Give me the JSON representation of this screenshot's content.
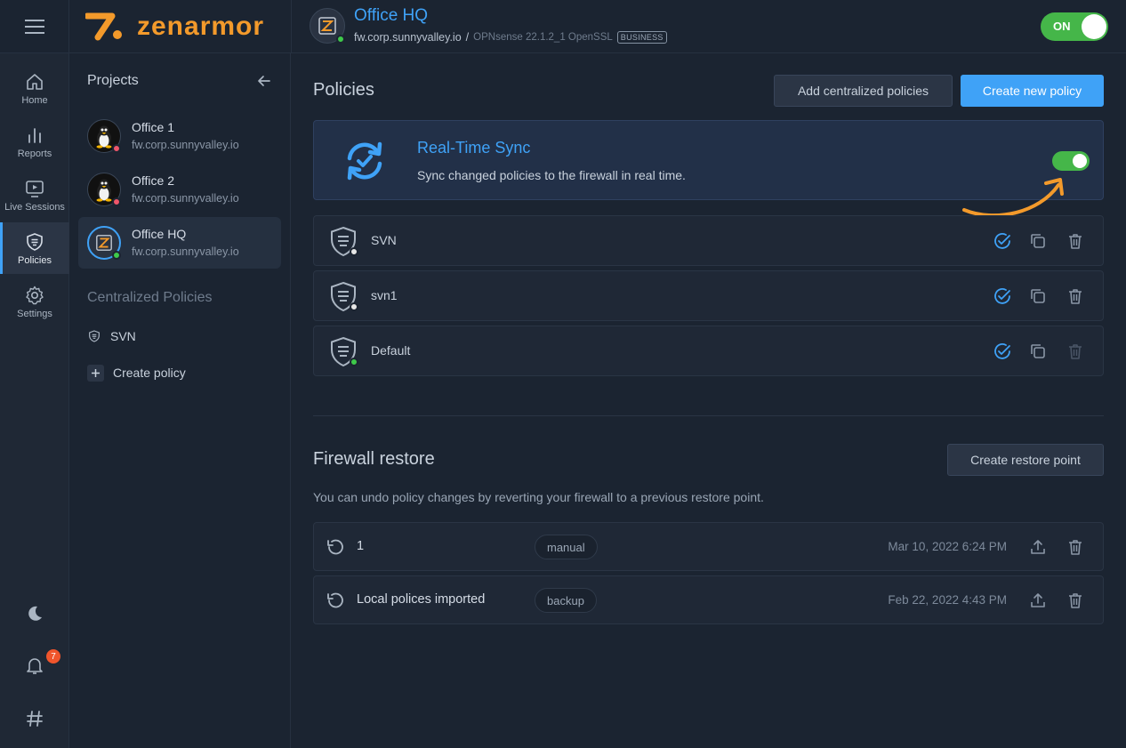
{
  "app": {
    "brand": "zenarmor",
    "brand_color": "#f39a2b",
    "accent": "#3fa2f7"
  },
  "header": {
    "firewall_name": "Office HQ",
    "host": "fw.corp.sunnyvalley.io",
    "separator": "/",
    "version": "OPNsense 22.1.2_1 OpenSSL",
    "edition": "BUSINESS",
    "power_label": "ON",
    "power_on": true
  },
  "rail": {
    "items": [
      {
        "label": "Home",
        "icon": "home-icon"
      },
      {
        "label": "Reports",
        "icon": "chart-icon"
      },
      {
        "label": "Live Sessions",
        "icon": "monitor-play-icon"
      },
      {
        "label": "Policies",
        "icon": "shield-icon",
        "active": true
      },
      {
        "label": "Settings",
        "icon": "gear-icon"
      }
    ],
    "notification_count": "7"
  },
  "projects": {
    "title": "Projects",
    "items": [
      {
        "name": "Office 1",
        "host": "fw.corp.sunnyvalley.io",
        "status": "offline"
      },
      {
        "name": "Office 2",
        "host": "fw.corp.sunnyvalley.io",
        "status": "offline"
      },
      {
        "name": "Office HQ",
        "host": "fw.corp.sunnyvalley.io",
        "status": "online",
        "active": true
      }
    ],
    "centralized_title": "Centralized Policies",
    "centralized_items": [
      {
        "label": "SVN"
      }
    ],
    "create_policy_label": "Create policy"
  },
  "policies": {
    "title": "Policies",
    "add_centralized_label": "Add centralized policies",
    "create_new_label": "Create new policy",
    "sync": {
      "title": "Real-Time Sync",
      "description": "Sync changed policies to the firewall in real time.",
      "enabled": true
    },
    "rows": [
      {
        "name": "SVN",
        "status": "inactive"
      },
      {
        "name": "svn1",
        "status": "inactive"
      },
      {
        "name": "Default",
        "status": "active"
      }
    ]
  },
  "restore": {
    "title": "Firewall restore",
    "create_label": "Create restore point",
    "description": "You can undo policy changes by reverting your firewall to a previous restore point.",
    "rows": [
      {
        "name": "1",
        "tag": "manual",
        "date": "Mar 10, 2022 6:24 PM"
      },
      {
        "name": "Local polices imported",
        "tag": "backup",
        "date": "Feb 22, 2022 4:43 PM"
      }
    ]
  }
}
